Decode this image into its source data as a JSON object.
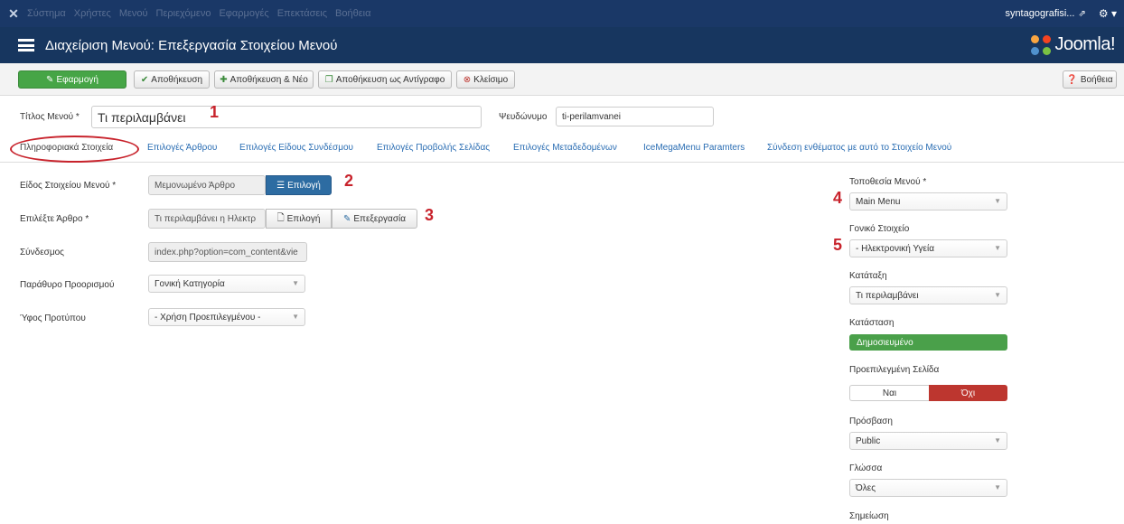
{
  "topnav": {
    "logo_icon": "joomla-x-icon",
    "items": [
      "Σύστημα",
      "Χρήστες",
      "Μενού",
      "Περιεχόμενο",
      "Εφαρμογές",
      "Επεκτάσεις",
      "Βοήθεια"
    ],
    "site_name": "syntagografisi...",
    "external_icon": "⇗",
    "gear_icon": "⚙ ▾"
  },
  "header": {
    "title": "Διαχείριση Μενού: Επεξεργασία Στοιχείου Μενού",
    "brand": "Joomla!"
  },
  "toolbar": {
    "apply": "Εφαρμογή",
    "save": "Αποθήκευση",
    "save_new": "Αποθήκευση & Νέο",
    "save_copy": "Αποθήκευση ως Αντίγραφο",
    "close": "Κλείσιμο",
    "help": "Βοήθεια"
  },
  "title_row": {
    "title_label": "Τίτλος Μενού *",
    "title_value": "Τι περιλαμβάνει",
    "alias_label": "Ψευδώνυμο",
    "alias_value": "ti-perilamvanei"
  },
  "tabs": [
    "Πληροφοριακά Στοιχεία",
    "Επιλογές Άρθρου",
    "Επιλογές Είδους Συνδέσμου",
    "Επιλογές Προβολής Σελίδας",
    "Επιλογές Μεταδεδομένων",
    "IceMegaMenu Paramters",
    "Σύνδεση ενθέματος με αυτό το Στοιχείο Μενού"
  ],
  "details": {
    "type_label": "Είδος Στοιχείου Μενού *",
    "type_value": "Μεμονωμένο Άρθρο",
    "type_select": "Επιλογή",
    "article_label": "Επιλέξτε Άρθρο *",
    "article_value": "Τι περιλαμβάνει η Ηλεκτρ",
    "article_select": "Επιλογή",
    "article_edit": "Επεξεργασία",
    "link_label": "Σύνδεσμος",
    "link_value": "index.php?option=com_content&vie",
    "target_label": "Παράθυρο Προορισμού",
    "target_value": "Γονική Κατηγορία",
    "style_label": "Ύφος Προτύπου",
    "style_value": "- Χρήση Προεπιλεγμένου -"
  },
  "sidebar": {
    "menu_label": "Τοποθεσία Μενού *",
    "menu_value": "Main Menu",
    "parent_label": "Γονικό Στοιχείο",
    "parent_value": "- Ηλεκτρονική Υγεία",
    "order_label": "Κατάταξη",
    "order_value": "Τι περιλαμβάνει",
    "status_label": "Κατάσταση",
    "status_value": "Δημοσιευμένο",
    "default_label": "Προεπιλεγμένη Σελίδα",
    "default_yes": "Ναι",
    "default_no": "Όχι",
    "access_label": "Πρόσβαση",
    "access_value": "Public",
    "language_label": "Γλώσσα",
    "language_value": "Όλες",
    "note_label": "Σημείωση"
  },
  "markers": [
    "1",
    "2",
    "3",
    "4",
    "5"
  ],
  "colors": {
    "topnav": "#1a3867",
    "header": "#17365f",
    "apply_green": "#46a546",
    "primary_blue": "#2d6ca2",
    "status_green": "#4aa04a",
    "no_red": "#bd362f",
    "annotation_red": "#c8232c"
  }
}
